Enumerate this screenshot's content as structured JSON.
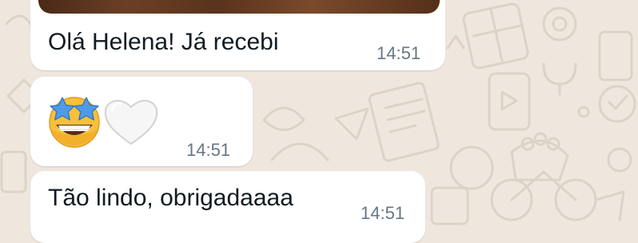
{
  "chat": {
    "messages": [
      {
        "text": "Olá Helena! Já recebi",
        "time": "14:51"
      },
      {
        "emojis": [
          "star-struck-emoji",
          "white-heart-emoji"
        ],
        "time": "14:51"
      },
      {
        "text": "Tão lindo, obrigadaaaa",
        "time": "14:51"
      }
    ]
  },
  "colors": {
    "wallpaper": "#efe7de",
    "bubble": "#ffffff",
    "text": "#111b21",
    "timestamp": "#667781"
  }
}
